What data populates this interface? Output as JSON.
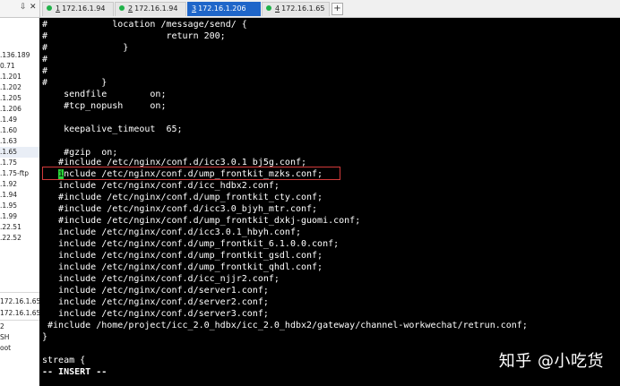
{
  "tabs": {
    "controls": {
      "pin": "⇩",
      "close": "✕"
    },
    "items": [
      {
        "num": "1",
        "label": "172.16.1.94",
        "active": false
      },
      {
        "num": "2",
        "label": "172.16.1.94",
        "active": false
      },
      {
        "num": "3",
        "label": "172.16.1.206",
        "active": true
      },
      {
        "num": "4",
        "label": "172.16.1.65",
        "active": false
      }
    ],
    "new_tab": "+"
  },
  "sidebar": {
    "items": [
      ".136.189",
      "0.71",
      ".1.201",
      ".1.202",
      ".1.205",
      ".1.206",
      ".1.49",
      ".1.60",
      ".1.63",
      ".1.65",
      ".1.75",
      ".1.75-ftp",
      ".1.92",
      ".1.94",
      ".1.95",
      ".1.99",
      ".22.51",
      ".22.52"
    ],
    "bottom_items": [
      "172.16.1.65",
      "172.16.1.65",
      "2",
      "SH",
      "oot"
    ]
  },
  "terminal": {
    "lines": [
      "#            location /message/send/ {",
      "#                      return 200;",
      "#              }",
      "#",
      "#",
      "#          }",
      "    sendfile        on;",
      "    #tcp_nopush     on;",
      "",
      "    keepalive_timeout  65;",
      "",
      "    #gzip  on;",
      "",
      "   #include /etc/nginx/conf.d/icc3.0.1_bj5g.conf;",
      "include /etc/nginx/conf.d/ump_frontkit_mzks.conf;",
      "   include /etc/nginx/conf.d/icc_hdbx2.conf;",
      "   #include /etc/nginx/conf.d/ump_frontkit_cty.conf;",
      "   #include /etc/nginx/conf.d/icc3.0_bjyh_mtr.conf;",
      "   #include /etc/nginx/conf.d/ump_frontkit_dxkj-guomi.conf;",
      "   include /etc/nginx/conf.d/icc3.0.1_hbyh.conf;",
      "   include /etc/nginx/conf.d/ump_frontkit_6.1.0.0.conf;",
      "   include /etc/nginx/conf.d/ump_frontkit_gsdl.conf;",
      "   include /etc/nginx/conf.d/ump_frontkit_qhdl.conf;",
      "   include /etc/nginx/conf.d/icc_njjr2.conf;",
      "   include /etc/nginx/conf.d/server1.conf;",
      "   include /etc/nginx/conf.d/server2.conf;",
      "   include /etc/nginx/conf.d/server3.conf;",
      " #include /home/project/icc_2.0_hdbx/icc_2.0_hdbx2/gateway/channel-workwechat/retrun.conf;",
      "}",
      "",
      "stream {"
    ],
    "cursor_char": "i",
    "mode_line": "-- INSERT --"
  },
  "watermark": "知乎 @小吃货",
  "colors": {
    "highlight_border": "#d23a3a",
    "cursor": "#2bd43a",
    "active_tab": "#1f66c9"
  }
}
